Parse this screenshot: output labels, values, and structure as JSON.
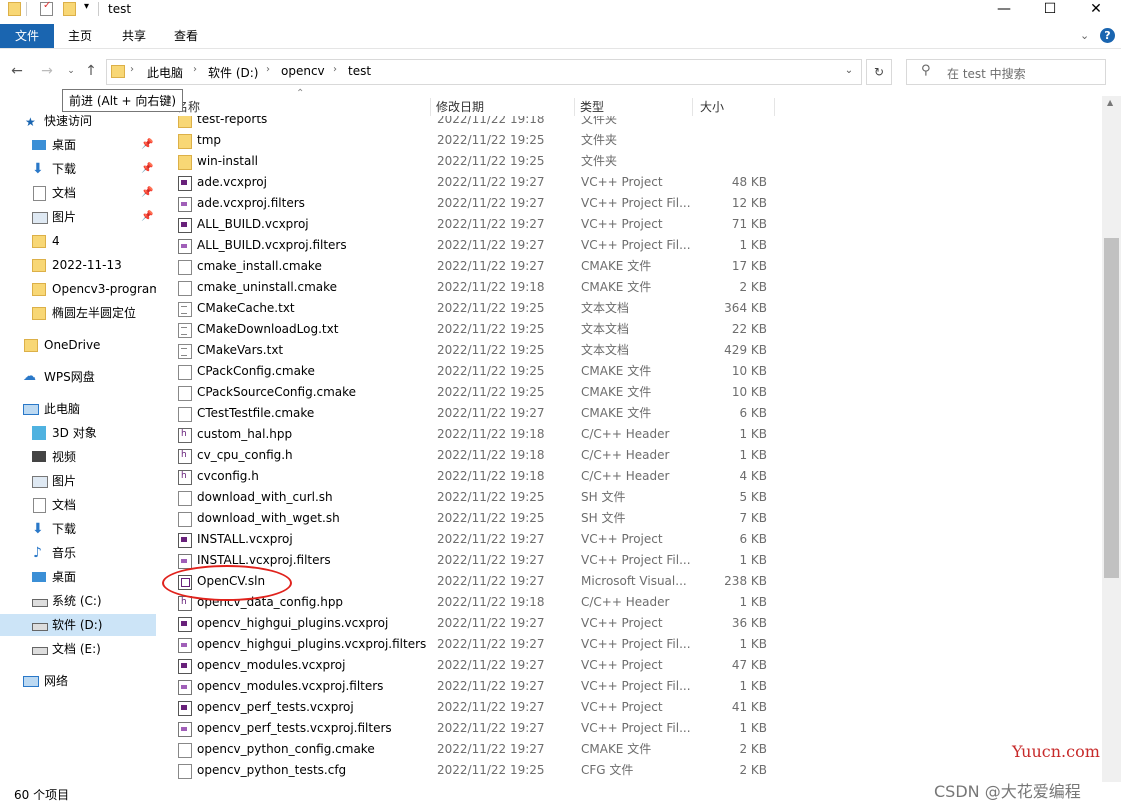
{
  "window": {
    "title": "test"
  },
  "ribbon": {
    "tabs": [
      "文件",
      "主页",
      "共享",
      "查看"
    ]
  },
  "address": {
    "crumbs": [
      "此电脑",
      "软件 (D:)",
      "opencv",
      "test"
    ]
  },
  "search": {
    "placeholder": "在 test 中搜索"
  },
  "tooltip": "前进 (Alt + 向右键)",
  "columns": {
    "name": "名称",
    "date": "修改日期",
    "type": "类型",
    "size": "大小"
  },
  "sidebar": {
    "items": [
      {
        "label": "快速访问",
        "icon": "star-icon"
      },
      {
        "label": "桌面",
        "icon": "desktop-icon",
        "pinned": true
      },
      {
        "label": "下载",
        "icon": "download-icon",
        "pinned": true
      },
      {
        "label": "文档",
        "icon": "documents-icon",
        "pinned": true
      },
      {
        "label": "图片",
        "icon": "pictures-icon",
        "pinned": true
      },
      {
        "label": "4",
        "icon": "folder-icon"
      },
      {
        "label": "2022-11-13",
        "icon": "folder-icon"
      },
      {
        "label": "Opencv3-program",
        "icon": "folder-icon"
      },
      {
        "label": "椭圆左半圆定位",
        "icon": "folder-icon"
      },
      {
        "label": "OneDrive",
        "icon": "onedrive-icon"
      },
      {
        "label": "WPS网盘",
        "icon": "cloud-icon"
      },
      {
        "label": "此电脑",
        "icon": "computer-icon"
      },
      {
        "label": "3D 对象",
        "icon": "3d-objects-icon"
      },
      {
        "label": "视频",
        "icon": "videos-icon"
      },
      {
        "label": "图片",
        "icon": "pictures-icon"
      },
      {
        "label": "文档",
        "icon": "documents-icon"
      },
      {
        "label": "下载",
        "icon": "download-icon"
      },
      {
        "label": "音乐",
        "icon": "music-icon"
      },
      {
        "label": "桌面",
        "icon": "desktop-icon"
      },
      {
        "label": "系统 (C:)",
        "icon": "drive-icon"
      },
      {
        "label": "软件 (D:)",
        "icon": "drive-icon",
        "selected": true
      },
      {
        "label": "文档 (E:)",
        "icon": "drive-icon"
      },
      {
        "label": "网络",
        "icon": "network-icon"
      }
    ]
  },
  "files": [
    {
      "name": "test-reports",
      "date": "2022/11/22 19:18",
      "type": "文件夹",
      "size": "",
      "icon": "folder"
    },
    {
      "name": "tmp",
      "date": "2022/11/22 19:25",
      "type": "文件夹",
      "size": "",
      "icon": "folder"
    },
    {
      "name": "win-install",
      "date": "2022/11/22 19:25",
      "type": "文件夹",
      "size": "",
      "icon": "folder"
    },
    {
      "name": "ade.vcxproj",
      "date": "2022/11/22 19:27",
      "type": "VC++ Project",
      "size": "48 KB",
      "icon": "proj"
    },
    {
      "name": "ade.vcxproj.filters",
      "date": "2022/11/22 19:27",
      "type": "VC++ Project Fil...",
      "size": "12 KB",
      "icon": "filter"
    },
    {
      "name": "ALL_BUILD.vcxproj",
      "date": "2022/11/22 19:27",
      "type": "VC++ Project",
      "size": "71 KB",
      "icon": "proj"
    },
    {
      "name": "ALL_BUILD.vcxproj.filters",
      "date": "2022/11/22 19:27",
      "type": "VC++ Project Fil...",
      "size": "1 KB",
      "icon": "filter"
    },
    {
      "name": "cmake_install.cmake",
      "date": "2022/11/22 19:27",
      "type": "CMAKE 文件",
      "size": "17 KB",
      "icon": "doc"
    },
    {
      "name": "cmake_uninstall.cmake",
      "date": "2022/11/22 19:18",
      "type": "CMAKE 文件",
      "size": "2 KB",
      "icon": "doc"
    },
    {
      "name": "CMakeCache.txt",
      "date": "2022/11/22 19:25",
      "type": "文本文档",
      "size": "364 KB",
      "icon": "text"
    },
    {
      "name": "CMakeDownloadLog.txt",
      "date": "2022/11/22 19:25",
      "type": "文本文档",
      "size": "22 KB",
      "icon": "text"
    },
    {
      "name": "CMakeVars.txt",
      "date": "2022/11/22 19:25",
      "type": "文本文档",
      "size": "429 KB",
      "icon": "text"
    },
    {
      "name": "CPackConfig.cmake",
      "date": "2022/11/22 19:25",
      "type": "CMAKE 文件",
      "size": "10 KB",
      "icon": "doc"
    },
    {
      "name": "CPackSourceConfig.cmake",
      "date": "2022/11/22 19:25",
      "type": "CMAKE 文件",
      "size": "10 KB",
      "icon": "doc"
    },
    {
      "name": "CTestTestfile.cmake",
      "date": "2022/11/22 19:27",
      "type": "CMAKE 文件",
      "size": "6 KB",
      "icon": "doc"
    },
    {
      "name": "custom_hal.hpp",
      "date": "2022/11/22 19:18",
      "type": "C/C++ Header",
      "size": "1 KB",
      "icon": "hpp"
    },
    {
      "name": "cv_cpu_config.h",
      "date": "2022/11/22 19:18",
      "type": "C/C++ Header",
      "size": "1 KB",
      "icon": "hpp"
    },
    {
      "name": "cvconfig.h",
      "date": "2022/11/22 19:18",
      "type": "C/C++ Header",
      "size": "4 KB",
      "icon": "hpp"
    },
    {
      "name": "download_with_curl.sh",
      "date": "2022/11/22 19:25",
      "type": "SH 文件",
      "size": "5 KB",
      "icon": "doc"
    },
    {
      "name": "download_with_wget.sh",
      "date": "2022/11/22 19:25",
      "type": "SH 文件",
      "size": "7 KB",
      "icon": "doc"
    },
    {
      "name": "INSTALL.vcxproj",
      "date": "2022/11/22 19:27",
      "type": "VC++ Project",
      "size": "6 KB",
      "icon": "proj"
    },
    {
      "name": "INSTALL.vcxproj.filters",
      "date": "2022/11/22 19:27",
      "type": "VC++ Project Fil...",
      "size": "1 KB",
      "icon": "filter"
    },
    {
      "name": "OpenCV.sln",
      "date": "2022/11/22 19:27",
      "type": "Microsoft Visual...",
      "size": "238 KB",
      "icon": "sln"
    },
    {
      "name": "opencv_data_config.hpp",
      "date": "2022/11/22 19:18",
      "type": "C/C++ Header",
      "size": "1 KB",
      "icon": "hpp"
    },
    {
      "name": "opencv_highgui_plugins.vcxproj",
      "date": "2022/11/22 19:27",
      "type": "VC++ Project",
      "size": "36 KB",
      "icon": "proj"
    },
    {
      "name": "opencv_highgui_plugins.vcxproj.filters",
      "date": "2022/11/22 19:27",
      "type": "VC++ Project Fil...",
      "size": "1 KB",
      "icon": "filter"
    },
    {
      "name": "opencv_modules.vcxproj",
      "date": "2022/11/22 19:27",
      "type": "VC++ Project",
      "size": "47 KB",
      "icon": "proj"
    },
    {
      "name": "opencv_modules.vcxproj.filters",
      "date": "2022/11/22 19:27",
      "type": "VC++ Project Fil...",
      "size": "1 KB",
      "icon": "filter"
    },
    {
      "name": "opencv_perf_tests.vcxproj",
      "date": "2022/11/22 19:27",
      "type": "VC++ Project",
      "size": "41 KB",
      "icon": "proj"
    },
    {
      "name": "opencv_perf_tests.vcxproj.filters",
      "date": "2022/11/22 19:27",
      "type": "VC++ Project Fil...",
      "size": "1 KB",
      "icon": "filter"
    },
    {
      "name": "opencv_python_config.cmake",
      "date": "2022/11/22 19:27",
      "type": "CMAKE 文件",
      "size": "2 KB",
      "icon": "doc"
    },
    {
      "name": "opencv_python_tests.cfg",
      "date": "2022/11/22 19:25",
      "type": "CFG 文件",
      "size": "2 KB",
      "icon": "doc"
    }
  ],
  "status": {
    "count": "60 个项目"
  },
  "watermarks": {
    "site": "Yuucn.com",
    "author": "CSDN @大花爱编程"
  },
  "colors": {
    "accent": "#1a65b0",
    "highlight": "#e0221c",
    "selected": "#cce4f7"
  }
}
